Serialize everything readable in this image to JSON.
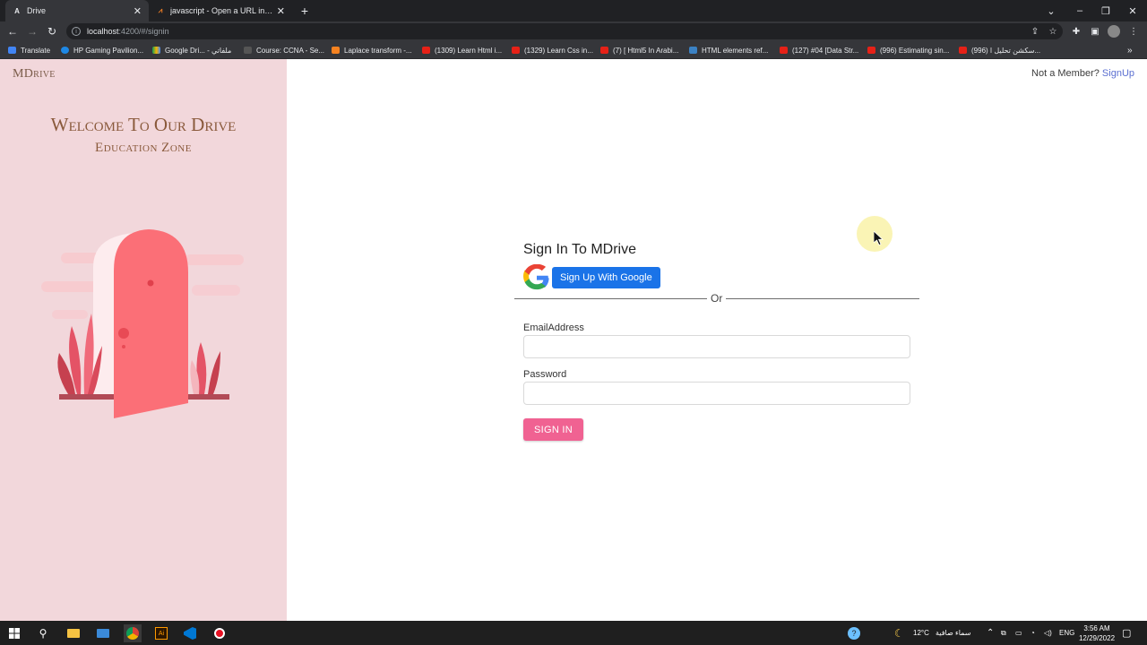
{
  "browser": {
    "tabs": [
      {
        "title": "Drive",
        "favicon": "angular-icon",
        "active": true
      },
      {
        "title": "javascript - Open a URL in a new",
        "favicon": "stackoverflow-icon",
        "active": false
      }
    ],
    "address": {
      "host": "localhost",
      "path": ":4200/#/signin"
    },
    "bookmarks": [
      {
        "label": "Translate",
        "icon": "translate-icon"
      },
      {
        "label": "HP Gaming Pavilion...",
        "icon": "globe-icon"
      },
      {
        "label": "Google Dri... - ملفاتي",
        "icon": "google-drive-icon"
      },
      {
        "label": "Course: CCNA - Se...",
        "icon": "page-icon"
      },
      {
        "label": "Laplace transform -...",
        "icon": "wolfram-icon"
      },
      {
        "label": "(1309) Learn Html i...",
        "icon": "youtube-icon"
      },
      {
        "label": "(1329) Learn Css in...",
        "icon": "youtube-icon"
      },
      {
        "label": "(7) [ Html5 In Arabi...",
        "icon": "youtube-icon"
      },
      {
        "label": "HTML elements ref...",
        "icon": "mdn-icon"
      },
      {
        "label": "(127) #04 [Data Str...",
        "icon": "youtube-icon"
      },
      {
        "label": "(996) Estimating sin...",
        "icon": "youtube-icon"
      },
      {
        "label": "(996) سكشن تحليل ا...",
        "icon": "youtube-icon"
      }
    ]
  },
  "page": {
    "brand": "MDrive",
    "welcome": "Welcome To Our Drive",
    "subtitle": "Education Zone",
    "signup_prompt": "Not a Member?",
    "signup_link": "SignUp",
    "form": {
      "title": "Sign In To MDrive",
      "google_button": "Sign Up With Google",
      "divider": "Or",
      "email_label": "EmailAddress",
      "email_value": "",
      "password_label": "Password",
      "password_value": "",
      "submit": "SIGN IN"
    },
    "colors": {
      "left_panel": "#f2d7db",
      "accent_pink": "#f06292",
      "google_blue": "#1a73e8",
      "link": "#5b6fd1"
    }
  },
  "taskbar": {
    "weather_temp": "12°C",
    "weather_text": "سماء صافية",
    "language": "ENG",
    "time": "3:56 AM",
    "date": "12/29/2022"
  }
}
